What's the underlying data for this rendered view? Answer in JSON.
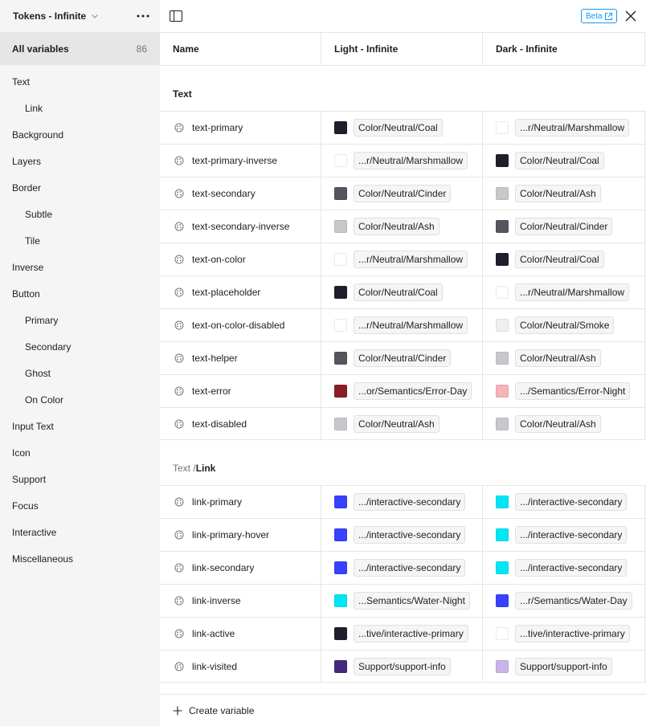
{
  "sidebar": {
    "title": "Tokens - Infinite",
    "all_label": "All variables",
    "all_count": "86",
    "items": [
      {
        "label": "Text",
        "sub": false
      },
      {
        "label": "Link",
        "sub": true
      },
      {
        "label": "Background",
        "sub": false
      },
      {
        "label": "Layers",
        "sub": false
      },
      {
        "label": "Border",
        "sub": false
      },
      {
        "label": "Subtle",
        "sub": true
      },
      {
        "label": "Tile",
        "sub": true
      },
      {
        "label": "Inverse",
        "sub": false
      },
      {
        "label": "Button",
        "sub": false
      },
      {
        "label": "Primary",
        "sub": true
      },
      {
        "label": "Secondary",
        "sub": true
      },
      {
        "label": "Ghost",
        "sub": true
      },
      {
        "label": "On Color",
        "sub": true
      },
      {
        "label": "Input Text",
        "sub": false
      },
      {
        "label": "Icon",
        "sub": false
      },
      {
        "label": "Support",
        "sub": false
      },
      {
        "label": "Focus",
        "sub": false
      },
      {
        "label": "Interactive",
        "sub": false
      },
      {
        "label": "Miscellaneous",
        "sub": false
      }
    ]
  },
  "topbar": {
    "beta_label": "Beta"
  },
  "table": {
    "col_name": "Name",
    "col_light": "Light - Infinite",
    "col_dark": "Dark - Infinite"
  },
  "groups": [
    {
      "prefix": "",
      "title": "Text",
      "rows": [
        {
          "name": "text-primary",
          "light": {
            "color": "#1e1e2d",
            "alias": "Color/Neutral/Coal"
          },
          "dark": {
            "color": "#ffffff",
            "alias": "...r/Neutral/Marshmallow"
          }
        },
        {
          "name": "text-primary-inverse",
          "light": {
            "color": "#ffffff",
            "alias": "...r/Neutral/Marshmallow"
          },
          "dark": {
            "color": "#1e1e2d",
            "alias": "Color/Neutral/Coal"
          }
        },
        {
          "name": "text-secondary",
          "light": {
            "color": "#55555f",
            "alias": "Color/Neutral/Cinder"
          },
          "dark": {
            "color": "#c8c8cc",
            "alias": "Color/Neutral/Ash"
          }
        },
        {
          "name": "text-secondary-inverse",
          "light": {
            "color": "#c8c8cc",
            "alias": "Color/Neutral/Ash"
          },
          "dark": {
            "color": "#55555f",
            "alias": "Color/Neutral/Cinder"
          }
        },
        {
          "name": "text-on-color",
          "light": {
            "color": "#ffffff",
            "alias": "...r/Neutral/Marshmallow"
          },
          "dark": {
            "color": "#1e1e2d",
            "alias": "Color/Neutral/Coal"
          }
        },
        {
          "name": "text-placeholder",
          "light": {
            "color": "#1e1e2d",
            "alias": "Color/Neutral/Coal"
          },
          "dark": {
            "color": "#ffffff",
            "alias": "...r/Neutral/Marshmallow"
          }
        },
        {
          "name": "text-on-color-disabled",
          "light": {
            "color": "#ffffff",
            "alias": "...r/Neutral/Marshmallow"
          },
          "dark": {
            "color": "#f0f0f0",
            "alias": "Color/Neutral/Smoke"
          }
        },
        {
          "name": "text-helper",
          "light": {
            "color": "#55555f",
            "alias": "Color/Neutral/Cinder"
          },
          "dark": {
            "color": "#c8c8cc",
            "alias": "Color/Neutral/Ash"
          }
        },
        {
          "name": "text-error",
          "light": {
            "color": "#8c1c26",
            "alias": "...or/Semantics/Error-Day"
          },
          "dark": {
            "color": "#f5b4b9",
            "alias": ".../Semantics/Error-Night"
          }
        },
        {
          "name": "text-disabled",
          "light": {
            "color": "#c8c8cc",
            "alias": "Color/Neutral/Ash"
          },
          "dark": {
            "color": "#c8c8cc",
            "alias": "Color/Neutral/Ash"
          }
        }
      ]
    },
    {
      "prefix": "Text / ",
      "title": "Link",
      "rows": [
        {
          "name": "link-primary",
          "light": {
            "color": "#3741ff",
            "alias": ".../interactive-secondary"
          },
          "dark": {
            "color": "#00e6f5",
            "alias": ".../interactive-secondary"
          }
        },
        {
          "name": "link-primary-hover",
          "light": {
            "color": "#3741ff",
            "alias": ".../interactive-secondary"
          },
          "dark": {
            "color": "#00e6f5",
            "alias": ".../interactive-secondary"
          }
        },
        {
          "name": "link-secondary",
          "light": {
            "color": "#3741ff",
            "alias": ".../interactive-secondary"
          },
          "dark": {
            "color": "#00e6f5",
            "alias": ".../interactive-secondary"
          }
        },
        {
          "name": "link-inverse",
          "light": {
            "color": "#00e6f5",
            "alias": "...Semantics/Water-Night"
          },
          "dark": {
            "color": "#3741ff",
            "alias": "...r/Semantics/Water-Day"
          }
        },
        {
          "name": "link-active",
          "light": {
            "color": "#1e1e2d",
            "alias": "...tive/interactive-primary"
          },
          "dark": {
            "color": "#ffffff",
            "alias": "...tive/interactive-primary"
          }
        },
        {
          "name": "link-visited",
          "light": {
            "color": "#46287d",
            "alias": "Support/support-info"
          },
          "dark": {
            "color": "#c8b4eb",
            "alias": "Support/support-info"
          }
        }
      ]
    }
  ],
  "footer": {
    "create_label": "Create variable"
  }
}
